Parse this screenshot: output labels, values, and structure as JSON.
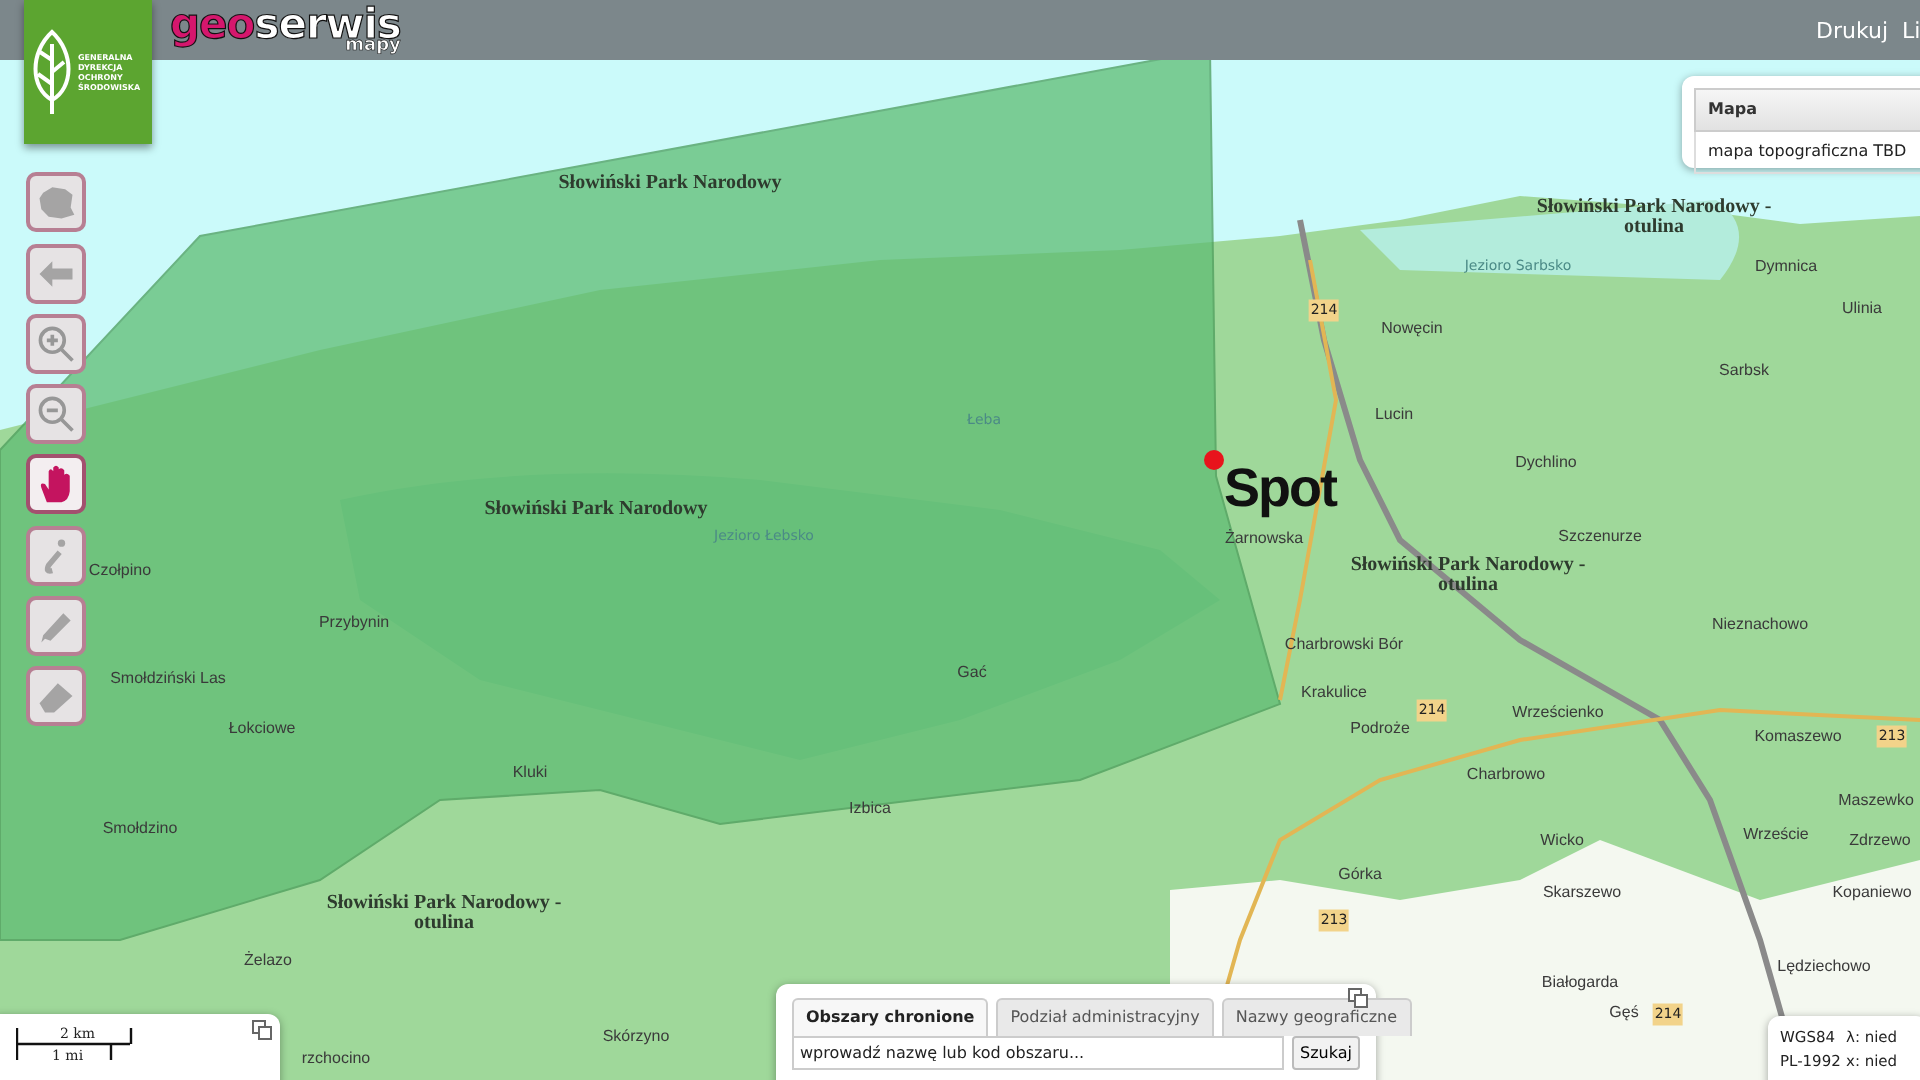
{
  "header": {
    "logo_lines": [
      "GENERALNA",
      "DYREKCJA",
      "OCHRONY",
      "ŚRODOWISKA"
    ],
    "brand": {
      "part_1": "geo",
      "part_2": "serwis",
      "subtitle": "mapy"
    },
    "menu": [
      "Drukuj",
      "Li"
    ]
  },
  "tools": [
    {
      "kind": "country",
      "selected": false
    },
    {
      "kind": "back",
      "selected": false
    },
    {
      "kind": "zoom_in",
      "selected": false
    },
    {
      "kind": "zoom_out",
      "selected": false
    },
    {
      "kind": "pan",
      "selected": true
    },
    {
      "kind": "info",
      "selected": false
    },
    {
      "kind": "draw",
      "selected": false
    },
    {
      "kind": "erase",
      "selected": false
    }
  ],
  "map_labels": [
    {
      "kind": "park",
      "text": "Słowiński Park Narodowy"
    },
    {
      "kind": "park",
      "text": "Słowiński Park Narodowy - otulina"
    },
    {
      "kind": "water",
      "text": "Jezioro Sarbsko"
    },
    {
      "kind": "place",
      "text": "Dymnica"
    },
    {
      "kind": "place",
      "text": "Ulinia"
    },
    {
      "kind": "place",
      "text": "Nowęcin"
    },
    {
      "kind": "place",
      "text": "Sarbsk"
    },
    {
      "kind": "water",
      "text": "Łeba"
    },
    {
      "kind": "place",
      "text": "Lucin"
    },
    {
      "kind": "place",
      "text": "Dychlino"
    },
    {
      "kind": "park",
      "text": "Słowiński Park Narodowy"
    },
    {
      "kind": "water",
      "text": "Jezioro Łebsko"
    },
    {
      "kind": "place",
      "text": "Żarnowska"
    },
    {
      "kind": "place",
      "text": "Szczenurze"
    },
    {
      "kind": "place",
      "text": "Czołpino"
    },
    {
      "kind": "park",
      "text": "Słowiński Park Narodowy - otulina"
    },
    {
      "kind": "place",
      "text": "Przybynin"
    },
    {
      "kind": "place",
      "text": "Nieznachowo"
    },
    {
      "kind": "place",
      "text": "Smołdziński Las"
    },
    {
      "kind": "place",
      "text": "Charbrowski Bór"
    },
    {
      "kind": "place",
      "text": "Gać"
    },
    {
      "kind": "place",
      "text": "Krakulice"
    },
    {
      "kind": "place",
      "text": "Wrześcienko"
    },
    {
      "kind": "place",
      "text": "Łokciowe"
    },
    {
      "kind": "place",
      "text": "Podroże"
    },
    {
      "kind": "place",
      "text": "Komaszewo"
    },
    {
      "kind": "place",
      "text": "Kluki"
    },
    {
      "kind": "place",
      "text": "Charbrowo"
    },
    {
      "kind": "place",
      "text": "Maszewko"
    },
    {
      "kind": "place",
      "text": "Izbica"
    },
    {
      "kind": "place",
      "text": "Smołdzino"
    },
    {
      "kind": "place",
      "text": "Wrzeście"
    },
    {
      "kind": "place",
      "text": "Wicko"
    },
    {
      "kind": "place",
      "text": "Zdrzewo"
    },
    {
      "kind": "place",
      "text": "Górka"
    },
    {
      "kind": "park",
      "text": "Słowiński Park Narodowy - otulina"
    },
    {
      "kind": "place",
      "text": "Skarszewo"
    },
    {
      "kind": "place",
      "text": "Kopaniewo"
    },
    {
      "kind": "place",
      "text": "Żelazo"
    },
    {
      "kind": "place",
      "text": "Lędziechowo"
    },
    {
      "kind": "place",
      "text": "Białogarda"
    },
    {
      "kind": "place",
      "text": "Gęś"
    },
    {
      "kind": "place",
      "text": "Skórzyno"
    },
    {
      "kind": "place",
      "text": "rzchocino"
    },
    {
      "kind": "road",
      "text": "214"
    },
    {
      "kind": "road",
      "text": "214"
    },
    {
      "kind": "road",
      "text": "213"
    },
    {
      "kind": "road",
      "text": "213"
    },
    {
      "kind": "road",
      "text": "214"
    }
  ],
  "marker": {
    "label": "Spot",
    "color": "#e8141c"
  },
  "layer_panel": {
    "title": "Mapa",
    "layer": "mapa topograficzna TBD"
  },
  "search_panel": {
    "tabs": [
      {
        "label": "Obszary chronione",
        "selected": true
      },
      {
        "label": "Podział administracyjny",
        "selected": false
      },
      {
        "label": "Nazwy geograficzne",
        "selected": false
      }
    ],
    "placeholder": "wprowadź nazwę lub kod obszaru...",
    "button": "Szukaj"
  },
  "scale": {
    "top": "2 km",
    "bottom": "1 mi"
  },
  "coordinates": [
    {
      "system": "WGS84",
      "value": "λ: nied"
    },
    {
      "system": "PL-1992",
      "value": "x: nied"
    }
  ]
}
